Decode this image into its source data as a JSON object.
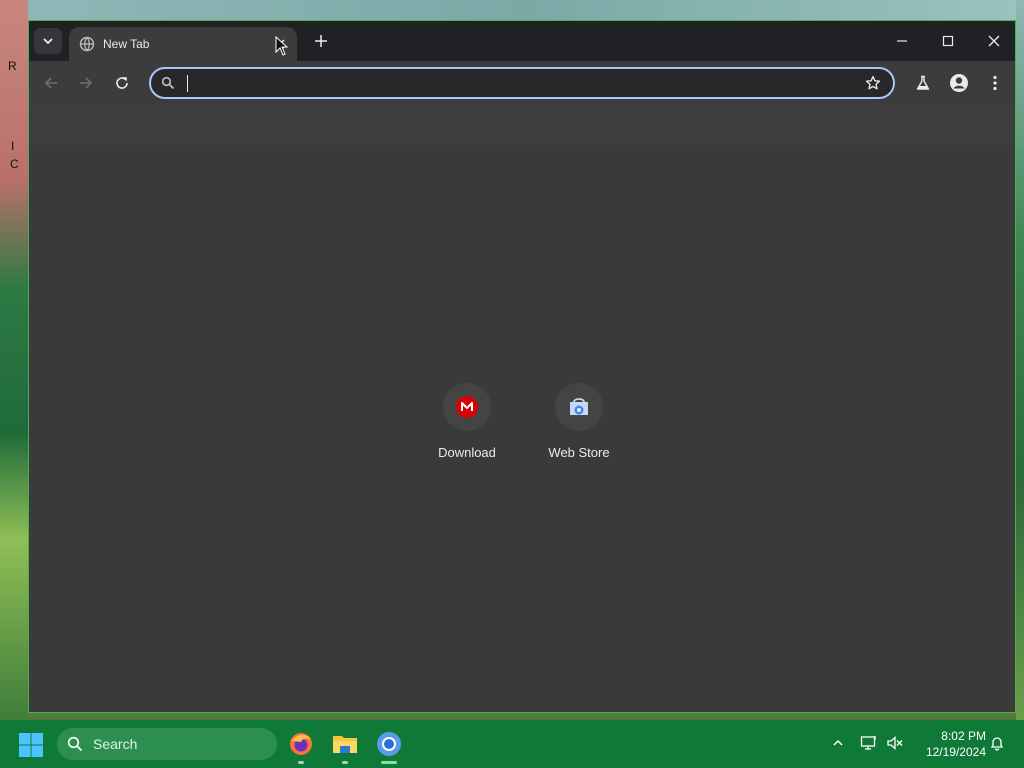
{
  "desktop": {
    "partial_letters": [
      "R",
      "I",
      "C"
    ]
  },
  "browser": {
    "tab": {
      "title": "New Tab"
    },
    "omnibox": {
      "value": "",
      "placeholder": ""
    },
    "shortcuts": [
      {
        "label": "Download",
        "icon": "mega-icon",
        "color": "#d90007"
      },
      {
        "label": "Web Store",
        "icon": "chrome-web-store-icon",
        "color": "#4285f4"
      }
    ]
  },
  "taskbar": {
    "search_label": "Search",
    "apps": [
      {
        "name": "firefox-icon"
      },
      {
        "name": "file-explorer-icon"
      },
      {
        "name": "chromium-icon"
      }
    ],
    "clock": {
      "time": "8:02 PM",
      "date": "12/19/2024"
    }
  },
  "colors": {
    "window_border": "#4caf50",
    "omnibox_focus": "#a8c7fa",
    "taskbar": "#0f7a37"
  }
}
